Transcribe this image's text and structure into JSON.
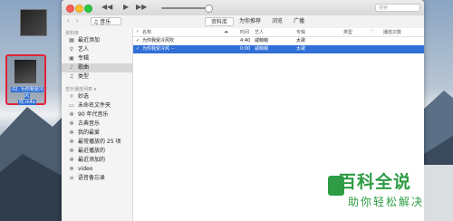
{
  "desktop": {
    "file_label_line1": "02. 为你我受冷风",
    "file_label_line2": "吹.m4a"
  },
  "window": {
    "search_placeholder": "搜索",
    "controls": {
      "rewind": "◀◀",
      "play": "▶",
      "forward": "▶▶"
    },
    "nav_back": "‹",
    "nav_forward": "›",
    "source_select": "♫ 音乐",
    "tabs": [
      {
        "label": "资料库",
        "active": true
      },
      {
        "label": "为你推荐",
        "active": false
      },
      {
        "label": "浏览",
        "active": false
      },
      {
        "label": "广播",
        "active": false
      }
    ]
  },
  "sidebar": {
    "library_header": "资料库",
    "library_items": [
      {
        "label": "最近添加",
        "icon": "grid-icon"
      },
      {
        "label": "艺人",
        "icon": "mic-icon"
      },
      {
        "label": "专辑",
        "icon": "album-icon"
      },
      {
        "label": "歌曲",
        "icon": "note-icon",
        "selected": true
      },
      {
        "label": "类型",
        "icon": "genre-icon"
      }
    ],
    "playlists_header": "音乐播放列表 ▾",
    "playlist_items": [
      {
        "label": "妙选",
        "icon": "genius-icon"
      },
      {
        "label": "未命名文件夹",
        "icon": "folder-icon"
      },
      {
        "label": "90 年代音乐",
        "icon": "gear-icon"
      },
      {
        "label": "古典音乐",
        "icon": "gear-icon"
      },
      {
        "label": "我的最爱",
        "icon": "gear-icon"
      },
      {
        "label": "最常播放的 25 项",
        "icon": "gear-icon"
      },
      {
        "label": "最近播放的",
        "icon": "gear-icon"
      },
      {
        "label": "最近添加的",
        "icon": "gear-icon"
      },
      {
        "label": "video",
        "icon": "gear-icon"
      },
      {
        "label": "语音备忘录",
        "icon": "list-icon"
      }
    ]
  },
  "table": {
    "columns": [
      "名称",
      "时间",
      "艺人",
      "专辑",
      "类型",
      "播放次数"
    ],
    "rows": [
      {
        "check": "✓",
        "name": "为你我受冷风吹",
        "time": "4:40",
        "artist": "戚萌萌",
        "album": "太歌",
        "selected": false
      },
      {
        "check": "✓",
        "name": "为你我受冷风 ···",
        "time": "0:00",
        "artist": "戚萌萌",
        "album": "太歌",
        "selected": true
      }
    ]
  },
  "watermark": {
    "title": "百科全说",
    "subtitle": "助你轻松解决"
  }
}
